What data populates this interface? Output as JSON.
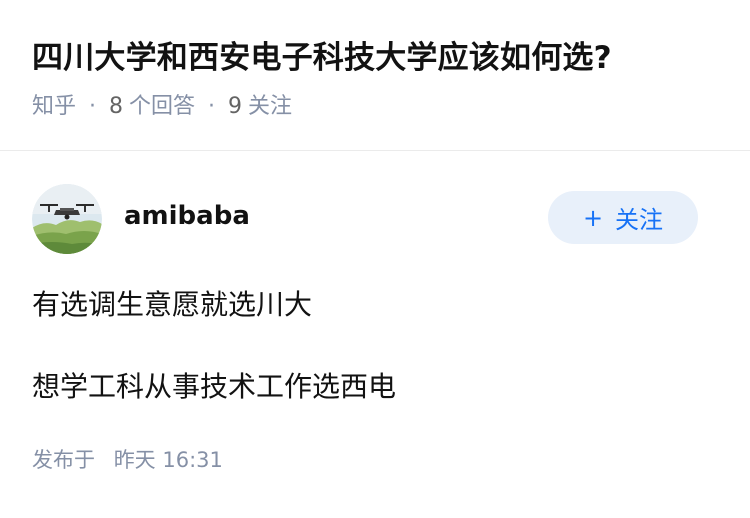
{
  "question": {
    "title": "四川大学和西安电子科技大学应该如何选?",
    "source": "知乎",
    "separator": "·",
    "answer_count": "8",
    "answer_label": "个回答",
    "follower_count": "9",
    "follower_label": "关注"
  },
  "answer": {
    "author": {
      "name": "amibaba",
      "avatar_icon": "drone-landscape-avatar"
    },
    "follow_button": {
      "icon": "plus-icon",
      "plus": "+",
      "label": "关注"
    },
    "paragraphs": [
      "有选调生意愿就选川大",
      "想学工科从事技术工作选西电"
    ],
    "published_label": "发布于",
    "published_time": "昨天 16:31"
  },
  "colors": {
    "accent": "#1772f6",
    "follow_bg": "#e8f0fa",
    "meta_text": "#8590a6",
    "divider": "#ebebeb"
  }
}
